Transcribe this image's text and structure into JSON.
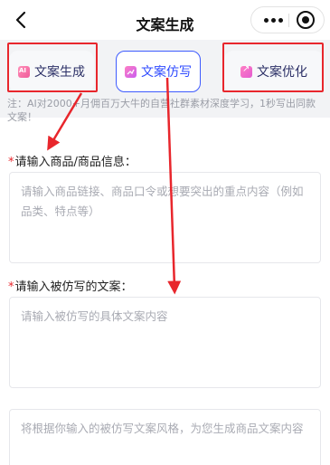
{
  "navbar": {
    "title": "文案生成"
  },
  "tabs": [
    {
      "label": "文案生成"
    },
    {
      "label": "文案仿写"
    },
    {
      "label": "文案优化"
    }
  ],
  "note": "注：AI对2000+月佣百万大牛的自营社群素材深度学习，1秒写出同款文案！",
  "form": {
    "product": {
      "label": "请输入商品/商品信息：",
      "placeholder": "请输入商品链接、商品口令或想要突出的重点内容（例如品类、特点等）"
    },
    "source": {
      "label": "请输入被仿写的文案：",
      "placeholder": "请输入被仿写的具体文案内容"
    },
    "result": {
      "placeholder": "将根据你输入的被仿写文案风格，为您生成商品文案内容"
    }
  },
  "colors": {
    "accent": "#3e5bff",
    "highlight": "#e8262c"
  }
}
